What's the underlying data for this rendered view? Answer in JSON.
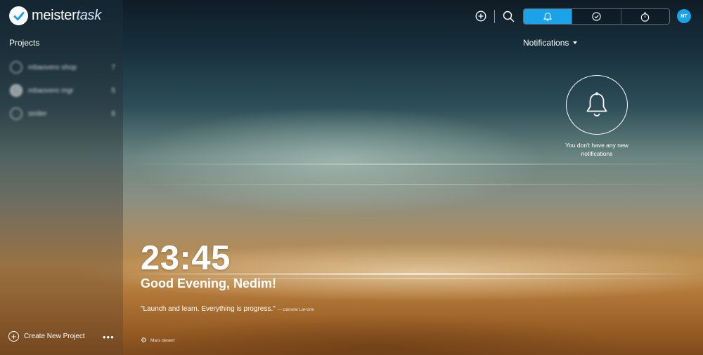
{
  "app": {
    "logo_bold": "meister",
    "logo_italic": "task"
  },
  "sidebar": {
    "title": "Projects",
    "projects": [
      {
        "name": "mbaovero shop",
        "count": "7"
      },
      {
        "name": "mbaovero mgr",
        "count": "5"
      },
      {
        "name": "smiler",
        "count": "6"
      }
    ],
    "create_label": "Create New Project",
    "more_label": "•••"
  },
  "topbar": {
    "avatar_initials": "NT",
    "tabs": [
      {
        "icon": "bell-icon",
        "active": true
      },
      {
        "icon": "check-circle-icon",
        "active": false
      },
      {
        "icon": "stopwatch-icon",
        "active": false
      }
    ]
  },
  "notifications": {
    "header": "Notifications",
    "empty_message": "You don't have any new notifications"
  },
  "dashboard": {
    "time": "23:45",
    "greeting": "Good Evening, Nedim!",
    "quote": "\"Launch and learn. Everything is progress.\"",
    "quote_author": "— Danielle LaPorte",
    "background_name": "Mars desert"
  },
  "colors": {
    "accent": "#1aa3e9"
  }
}
